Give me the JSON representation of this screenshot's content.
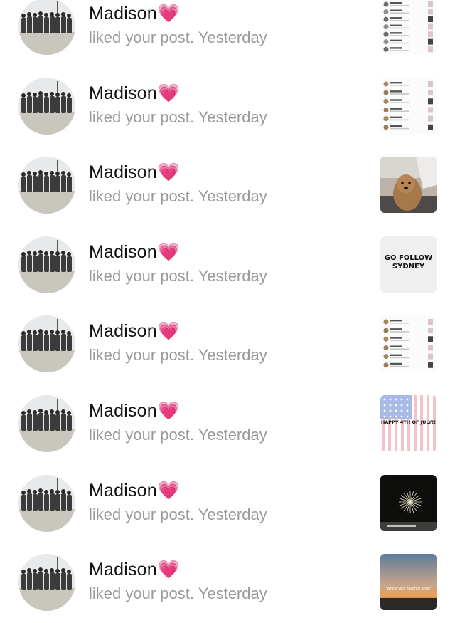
{
  "notifications": [
    {
      "name": "Madison",
      "heart": "💗",
      "action": "liked your post.",
      "time": "Yesterday",
      "thumb": "screenshot-list-icon"
    },
    {
      "name": "Madison",
      "heart": "💗",
      "action": "liked your post.",
      "time": "Yesterday",
      "thumb": "screenshot-list-icon"
    },
    {
      "name": "Madison",
      "heart": "💗",
      "action": "liked your post.",
      "time": "Yesterday",
      "thumb": "dog-photo-icon"
    },
    {
      "name": "Madison",
      "heart": "💗",
      "action": "liked your post.",
      "time": "Yesterday",
      "thumb": "text-card-icon",
      "thumb_text": "GO FOLLOW SYDNEY"
    },
    {
      "name": "Madison",
      "heart": "💗",
      "action": "liked your post.",
      "time": "Yesterday",
      "thumb": "screenshot-list-icon"
    },
    {
      "name": "Madison",
      "heart": "💗",
      "action": "liked your post.",
      "time": "Yesterday",
      "thumb": "flag-card-icon",
      "thumb_text": "HAPPY 4TH OF JULY!!"
    },
    {
      "name": "Madison",
      "heart": "💗",
      "action": "liked your post.",
      "time": "Yesterday",
      "thumb": "fireworks-photo-icon"
    },
    {
      "name": "Madison",
      "heart": "💗",
      "action": "liked your post.",
      "time": "Yesterday",
      "thumb": "sunset-photo-icon",
      "thumb_text": "\"Who's your favorite artist\""
    }
  ]
}
